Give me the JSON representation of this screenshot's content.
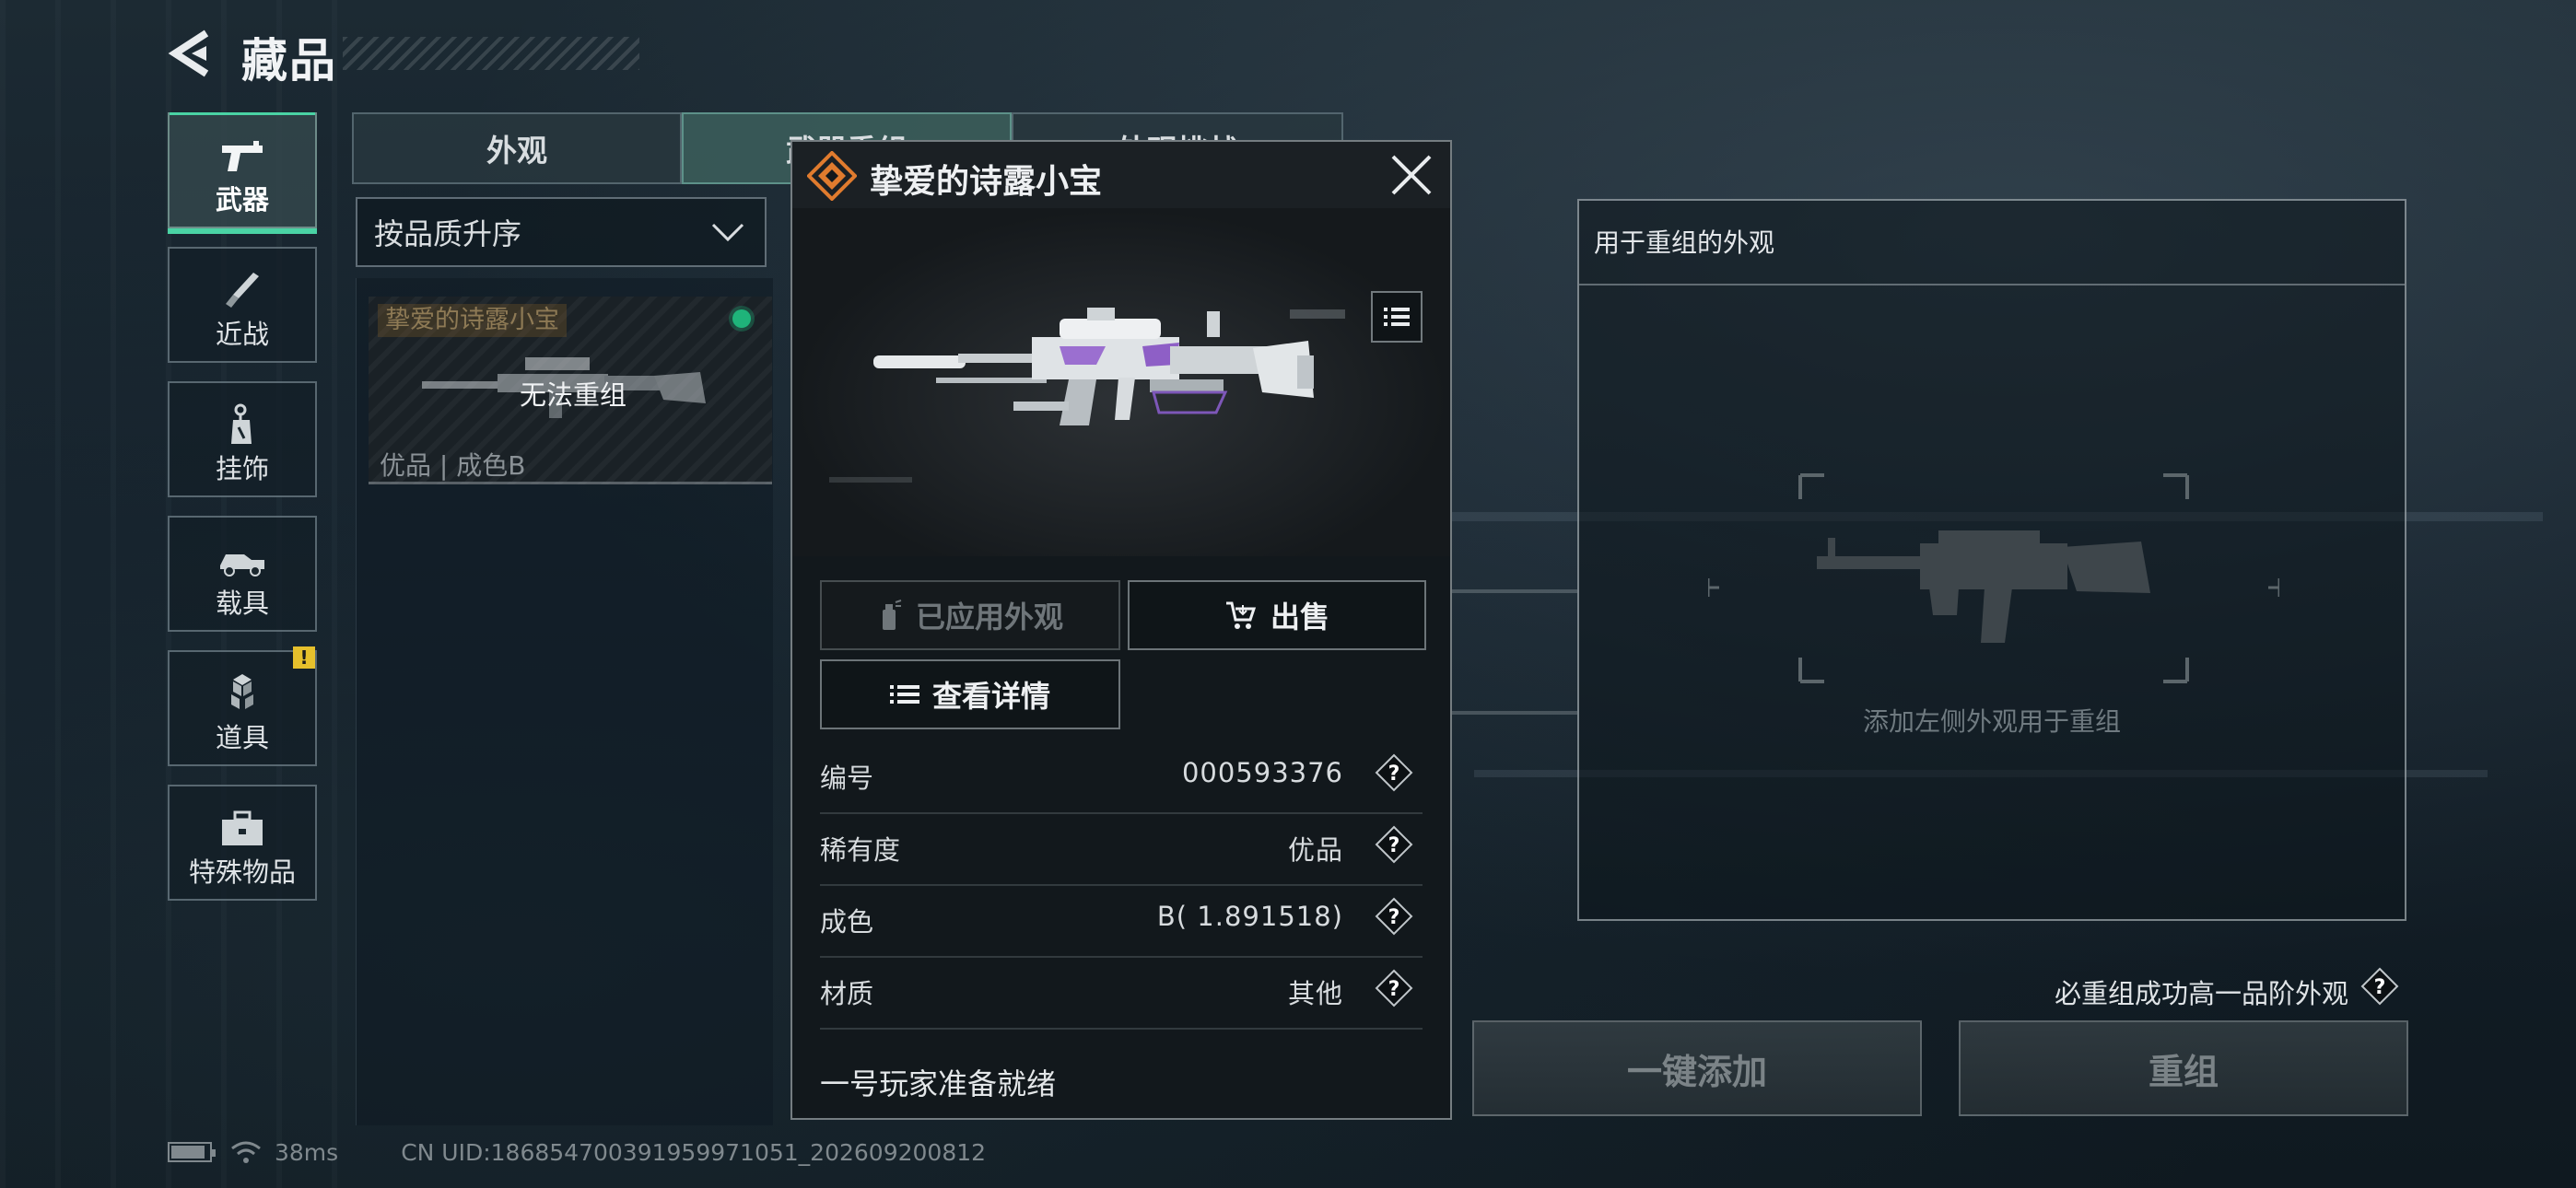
{
  "header": {
    "title": "藏品"
  },
  "sidebar": {
    "items": [
      {
        "label": "武器",
        "icon": "pistol-icon",
        "active": true
      },
      {
        "label": "近战",
        "icon": "knife-icon"
      },
      {
        "label": "挂饰",
        "icon": "charm-icon"
      },
      {
        "label": "载具",
        "icon": "vehicle-icon"
      },
      {
        "label": "道具",
        "icon": "cubes-icon",
        "badge": "!"
      },
      {
        "label": "特殊物品",
        "icon": "toolbox-icon"
      }
    ]
  },
  "tabs": [
    {
      "label": "外观"
    },
    {
      "label": "武器重组",
      "active": true
    },
    {
      "label": "外观挑战"
    }
  ],
  "sort": {
    "label": "按品质升序"
  },
  "skin_card": {
    "name": "挚爱的诗露小宝",
    "status": "无法重组",
    "meta": "优品 | 成色B"
  },
  "popup": {
    "title": "挚爱的诗露小宝",
    "buttons": {
      "applied": "已应用外观",
      "sell": "出售",
      "details": "查看详情"
    },
    "attributes": [
      {
        "label": "编号",
        "value": "000593376"
      },
      {
        "label": "稀有度",
        "value": "优品"
      },
      {
        "label": "成色",
        "value": "B( 1.891518)"
      },
      {
        "label": "材质",
        "value": "其他"
      }
    ],
    "footer": "一号玩家准备就绪"
  },
  "recombine_panel": {
    "title": "用于重组的外观",
    "hint": "添加左侧外观用于重组"
  },
  "guarantee_text": "必重组成功高一品阶外观",
  "actions": {
    "add_all": "一键添加",
    "recombine": "重组"
  },
  "status_bar": {
    "ping": "38ms",
    "uid": "CN UID:18685470039195997105​1_202609200812"
  },
  "colors": {
    "accent": "#4ad3a4",
    "emblem": "#e07b2e",
    "badge": "#e6c02c"
  }
}
